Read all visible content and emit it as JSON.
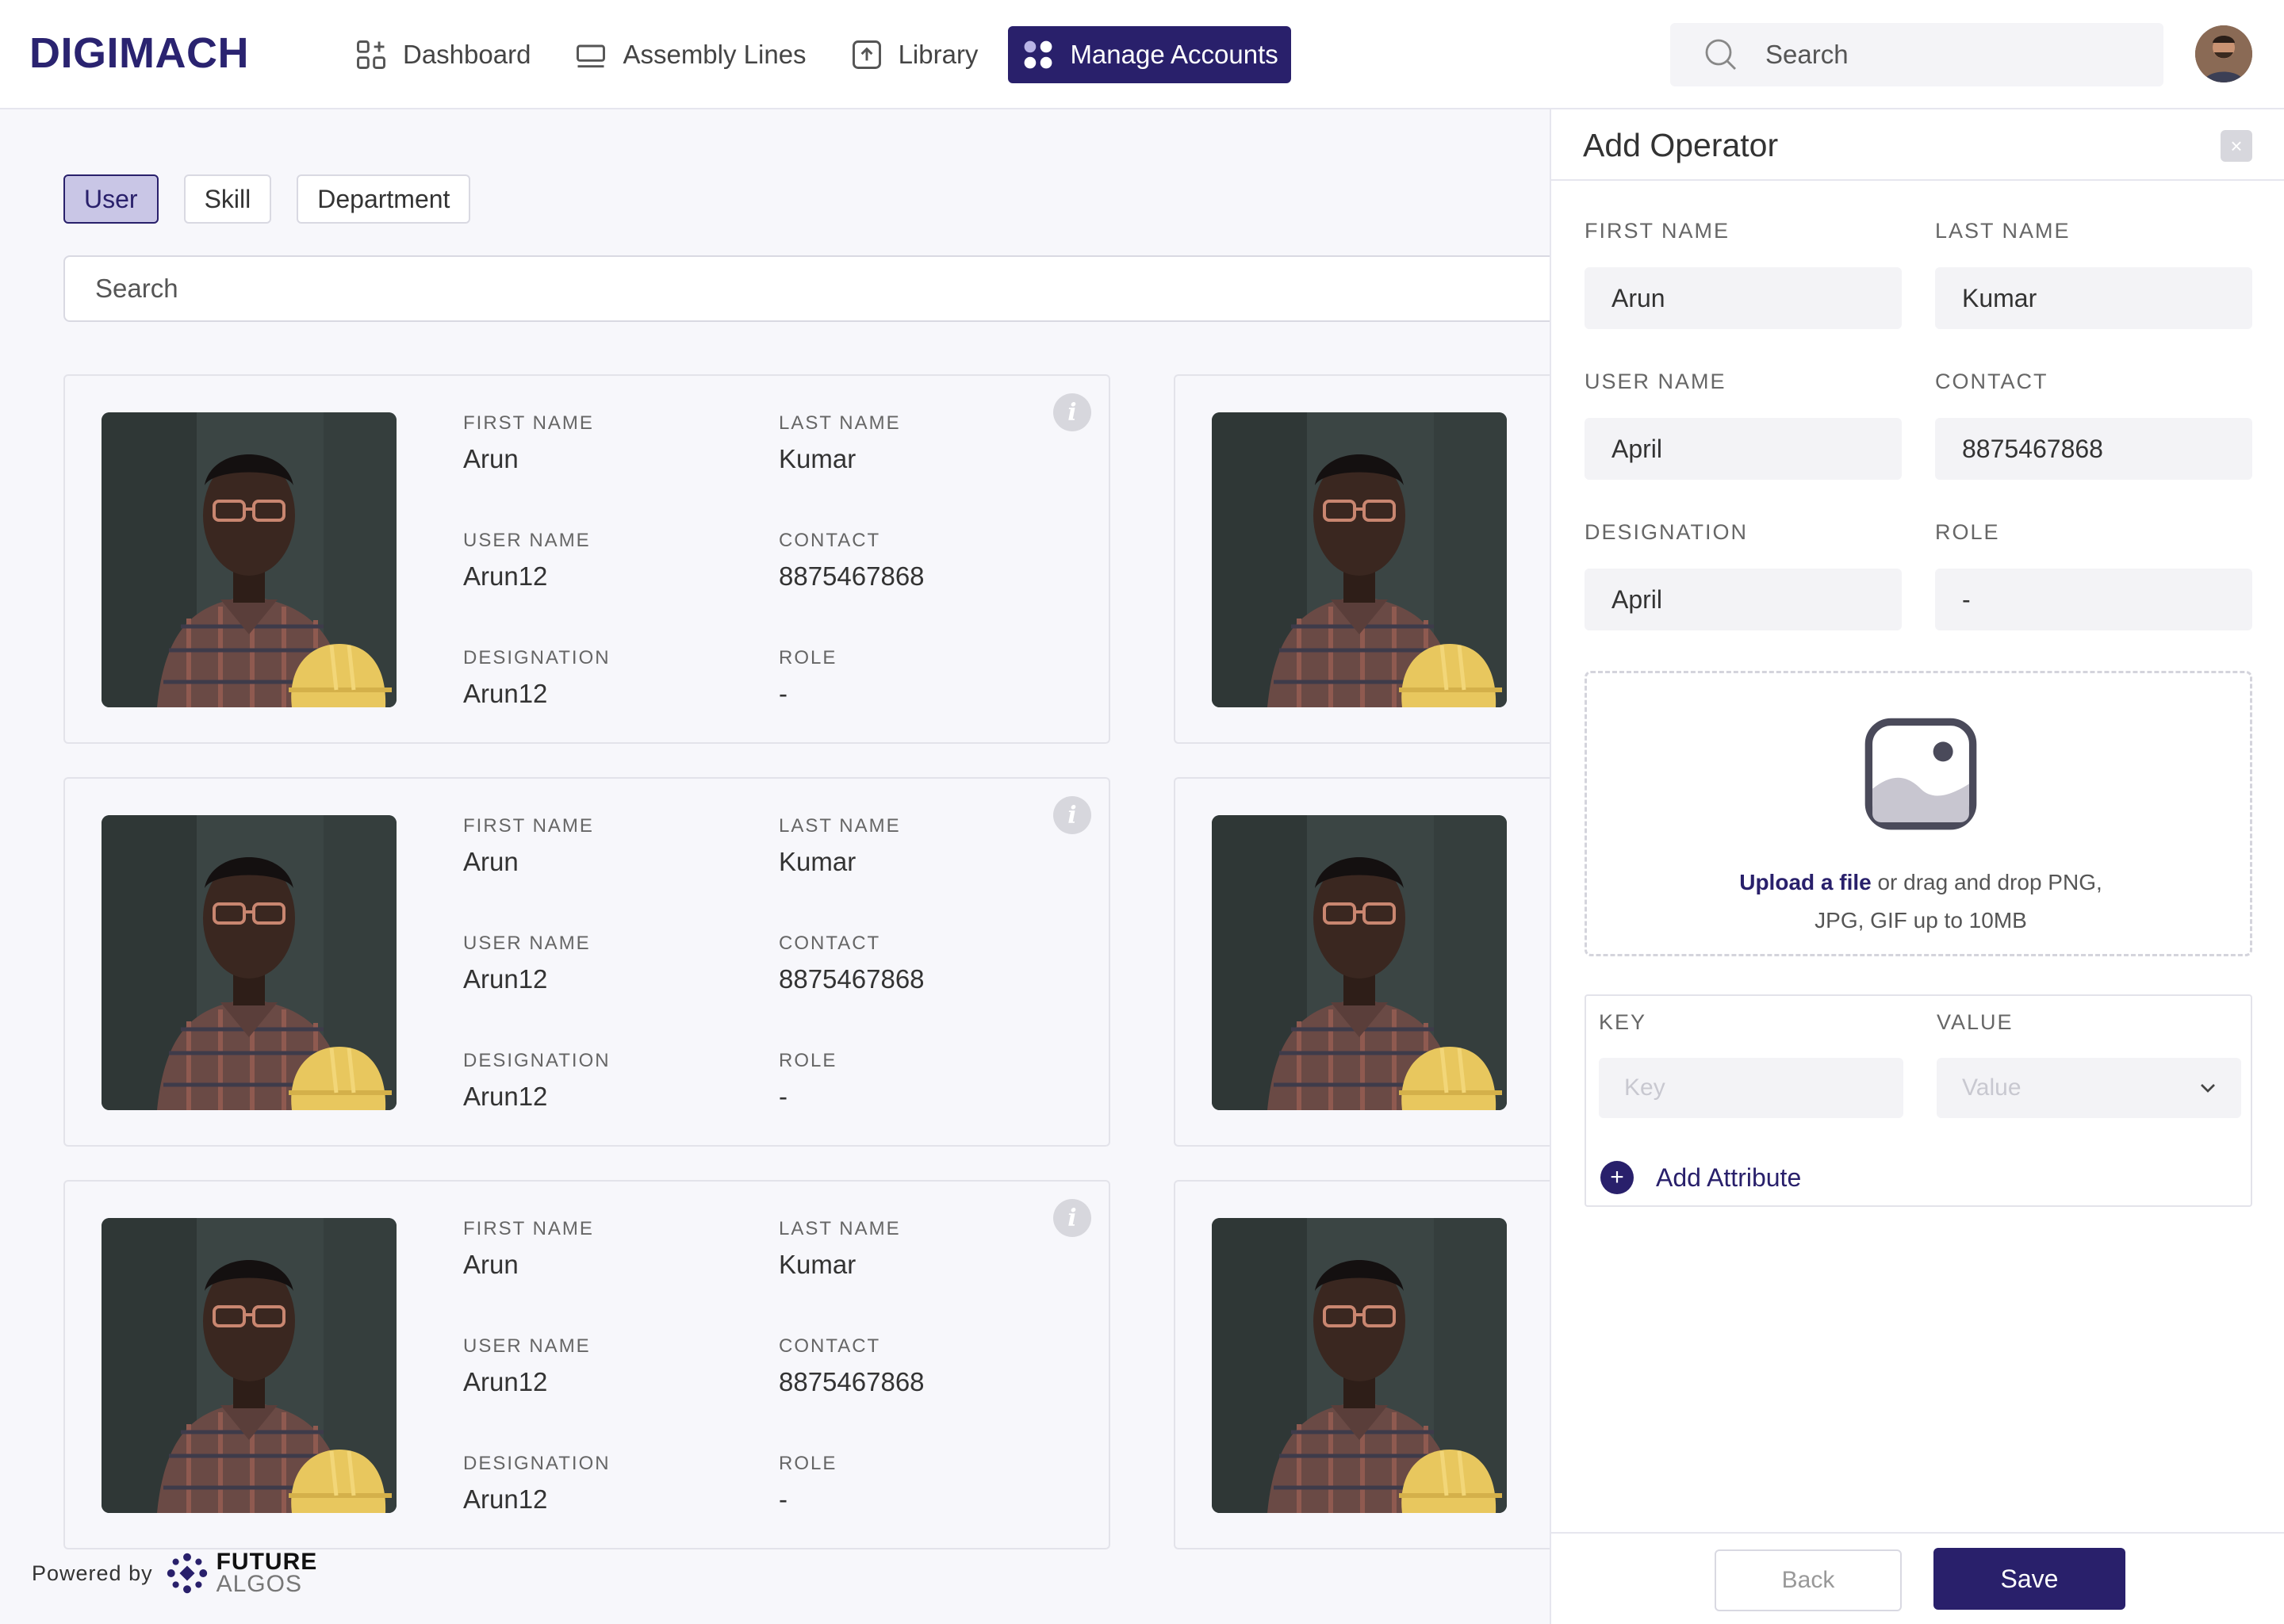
{
  "brand": "DIGIMACH",
  "nav": [
    {
      "label": "Dashboard",
      "icon": "dashboard-icon"
    },
    {
      "label": "Assembly Lines",
      "icon": "assembly-lines-icon"
    },
    {
      "label": "Library",
      "icon": "library-upload-icon"
    },
    {
      "label": "Manage Accounts",
      "icon": "manage-accounts-icon",
      "active": true
    }
  ],
  "header": {
    "search_placeholder": "Search"
  },
  "tabs": [
    {
      "label": "User",
      "active": true
    },
    {
      "label": "Skill"
    },
    {
      "label": "Department"
    }
  ],
  "main_search": {
    "placeholder": "Search"
  },
  "card_labels": {
    "first_name": "FIRST NAME",
    "last_name": "LAST NAME",
    "user_name": "USER NAME",
    "contact": "CONTACT",
    "designation": "DESIGNATION",
    "role": "ROLE"
  },
  "users": [
    {
      "first_name": "Arun",
      "last_name": "Kumar",
      "user_name": "Arun12",
      "contact": "8875467868",
      "designation": "Arun12",
      "role": "-"
    },
    {
      "first_name": "Arun",
      "last_name": "Kumar",
      "user_name": "Arun12",
      "contact": "8875467868",
      "designation": "Arun12",
      "role": "-"
    },
    {
      "first_name": "Arun",
      "last_name": "Kumar",
      "user_name": "Arun12",
      "contact": "8875467868",
      "designation": "Arun12",
      "role": "-"
    }
  ],
  "footer": {
    "powered_by": "Powered by",
    "logo_line1": "FUTURE",
    "logo_line2": "ALGOS"
  },
  "drawer": {
    "title": "Add Operator",
    "close": "×",
    "fields": {
      "first_name": {
        "label": "FIRST NAME",
        "value": "Arun"
      },
      "last_name": {
        "label": "LAST NAME",
        "value": "Kumar"
      },
      "user_name": {
        "label": "USER NAME",
        "value": "April"
      },
      "contact": {
        "label": "CONTACT",
        "value": "8875467868"
      },
      "designation": {
        "label": "DESIGNATION",
        "value": "April"
      },
      "role": {
        "label": "ROLE",
        "value": "-"
      }
    },
    "upload": {
      "link": "Upload a file",
      "text": " or drag and drop PNG,",
      "text2": "JPG, GIF up to 10MB"
    },
    "attributes": {
      "key_label": "KEY",
      "value_label": "VALUE",
      "key_placeholder": "Key",
      "value_placeholder": "Value",
      "add_label": "Add Attribute"
    },
    "back": "Back",
    "save": "Save"
  },
  "colors": {
    "primary": "#29206b",
    "background": "#f7f7fb",
    "active_tab_bg": "#c9c6e6"
  }
}
